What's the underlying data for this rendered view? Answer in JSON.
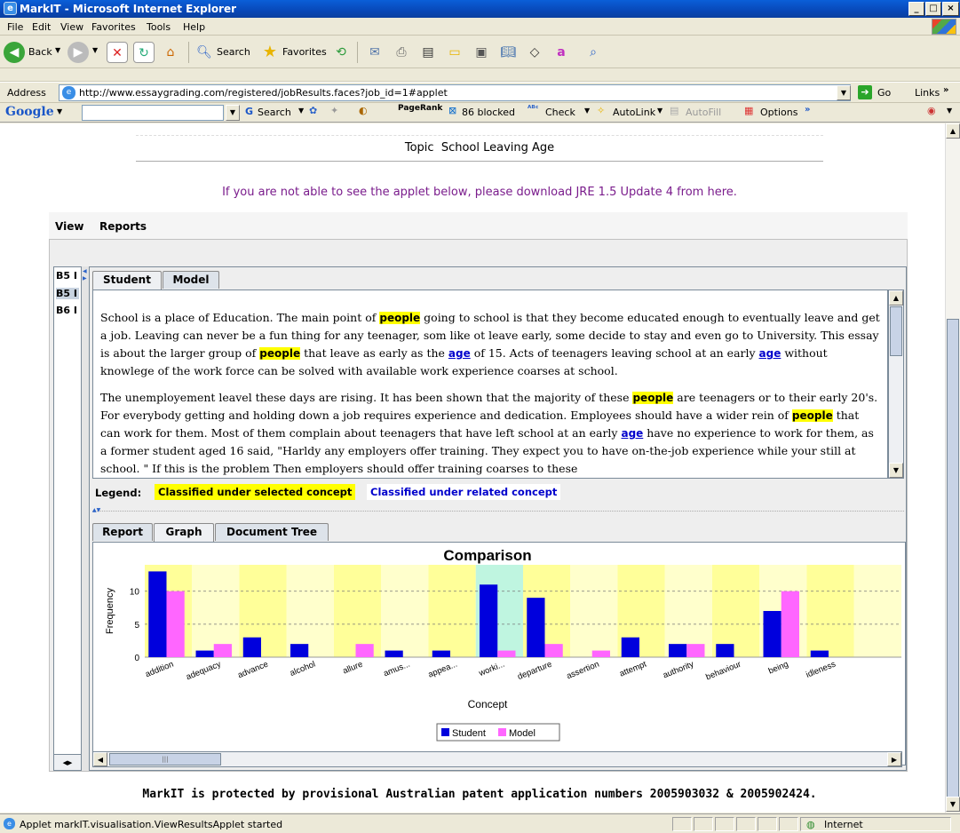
{
  "window": {
    "title": "MarkIT - Microsoft Internet Explorer"
  },
  "menu": {
    "items": [
      "File",
      "Edit",
      "View",
      "Favorites",
      "Tools",
      "Help"
    ]
  },
  "toolbar": {
    "back_label": "Back",
    "search_label": "Search",
    "favorites_label": "Favorites"
  },
  "address": {
    "label": "Address",
    "url": "http://www.essaygrading.com/registered/jobResults.faces?job_id=1#applet",
    "go_label": "Go",
    "links_label": "Links"
  },
  "googlebar": {
    "brand": "Google",
    "search_label": "Search",
    "pagerank_label": "PageRank",
    "blocked_label": "86 blocked",
    "check_label": "Check",
    "autolink_label": "AutoLink",
    "autofill_label": "AutoFill",
    "options_label": "Options"
  },
  "page": {
    "topic_label": "Topic",
    "topic_value": "School Leaving Age",
    "jre_message": "If you are not able to see the applet below, please download JRE 1.5 Update 4 from here.",
    "patent_notice": "MarkIT is protected by provisional Australian patent application numbers 2005903032 & 2005902424."
  },
  "applet": {
    "menu": {
      "view": "View",
      "reports": "Reports"
    },
    "list": [
      "B5 I",
      "B5 I",
      "B6 I"
    ],
    "top_tabs": [
      "Student",
      "Model"
    ],
    "bottom_tabs": [
      "Report",
      "Graph",
      "Document Tree"
    ],
    "legend": {
      "label": "Legend:",
      "selected": "Classified under selected concept",
      "related": "Classified under related concept"
    }
  },
  "essay": {
    "p1": {
      "a": "School is a place of Education. The main point of ",
      "k1": "people",
      "b": " going to school is that they become educated enough to eventually leave and get a job. Leaving can never be a fun thing for any teenager, som like ot leave early, some decide to stay and even go to University. This essay is about the larger group of ",
      "k2": "people",
      "c": " that leave as early as the ",
      "r1": "age",
      "d": " of 15. Acts of teenagers leaving school at an early ",
      "r2": "age",
      "e": " without knowlege of the work force can be solved with available work experience coarses at school."
    },
    "p2": {
      "a": "The unemployement leavel these days are rising. It has been shown that the majority of these ",
      "k1": "people",
      "b": " are teenagers or to their early 20's. For everybody getting and holding down a job requires experience and dedication. Employees should have a wider rein of ",
      "k2": "people",
      "c": " that can work for them. Most of them complain about teenagers that have left school at an early ",
      "r1": "age",
      "d": " have no experience to work for them, as a former student aged 16 said, \"Harldy any employers offer training. They expect you to have on-the-job experience while your still at school. \" If this is the problem Then employers should offer training coarses to these"
    }
  },
  "status": {
    "text": "Applet markIT.visualisation.ViewResultsApplet started",
    "zone": "Internet"
  },
  "colors": {
    "student": "#0000dd",
    "model": "#ff66ff",
    "highlight": "#ffff00",
    "related": "#0000cc"
  },
  "chart_data": {
    "type": "bar",
    "title": "Comparison",
    "xlabel": "Concept",
    "ylabel": "Frequency",
    "ylim": [
      0,
      14
    ],
    "yticks": [
      0,
      5,
      10
    ],
    "categories": [
      "addition",
      "adequacy",
      "advance",
      "alcohol",
      "allure",
      "amus...",
      "appea...",
      "worki...",
      "departure",
      "assertion",
      "attempt",
      "authority",
      "behaviour",
      "being",
      "idleness"
    ],
    "series": [
      {
        "name": "Student",
        "values": [
          13,
          1,
          3,
          2,
          0,
          1,
          1,
          11,
          9,
          0,
          3,
          2,
          2,
          7,
          1
        ]
      },
      {
        "name": "Model",
        "values": [
          10,
          2,
          0,
          0,
          2,
          0,
          0,
          1,
          2,
          1,
          0,
          2,
          0,
          10,
          0
        ]
      }
    ],
    "highlighted_category": "worki...",
    "legend_position": "bottom-center",
    "grid": true
  }
}
